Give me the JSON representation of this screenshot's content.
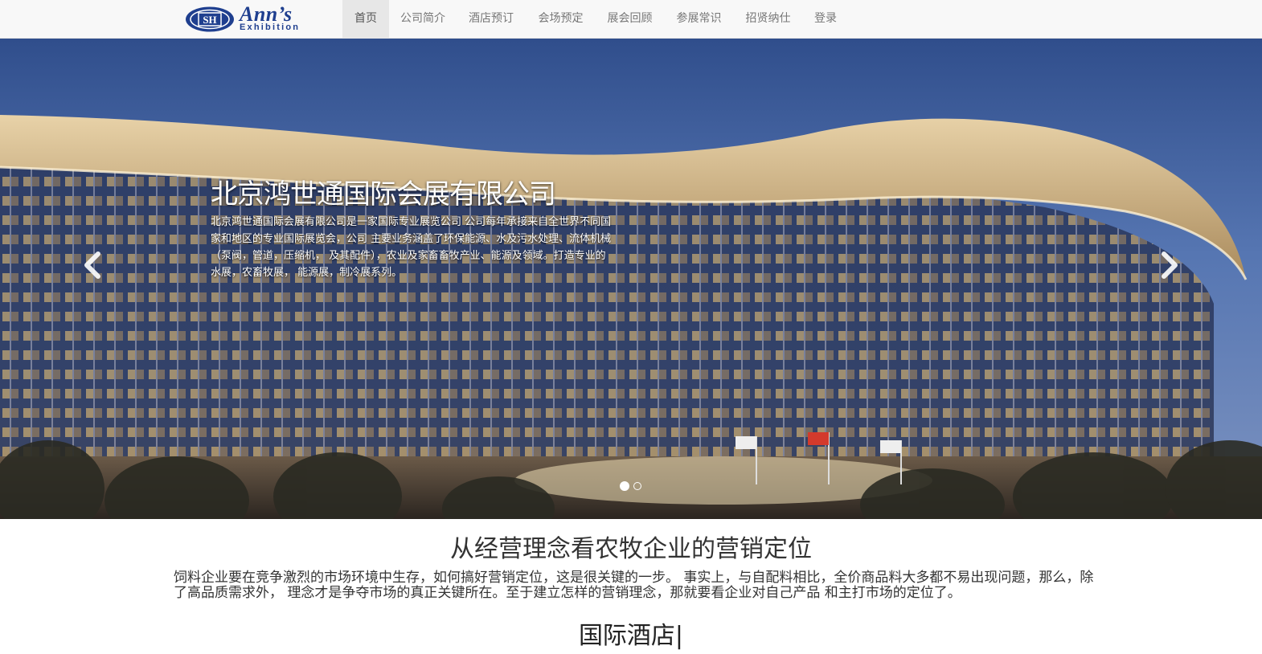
{
  "header": {
    "logo": {
      "brand": "Ann’s",
      "sub": "Exhibition",
      "mark": "SH"
    },
    "nav": [
      {
        "label": "首页",
        "active": true
      },
      {
        "label": "公司简介",
        "active": false
      },
      {
        "label": "酒店预订",
        "active": false
      },
      {
        "label": "会场预定",
        "active": false
      },
      {
        "label": "展会回顾",
        "active": false
      },
      {
        "label": "参展常识",
        "active": false
      },
      {
        "label": "招贤纳仕",
        "active": false
      },
      {
        "label": "登录",
        "active": false
      }
    ]
  },
  "hero": {
    "title": "北京鸿世通国际会展有限公司",
    "description": "北京鸿世通国际会展有限公司是一家国际专业展览公司 公司每年承接来自全世界不同国家和地区的专业国际展览会，公司 主要业务涵盖了环保能源、水及污水处理、流体机械（泵阀，管道，压缩机， 及其配件），农业及家畜畜牧产业、能源及领域。打造专业的水展，农畜牧展， 能源展，制冷展系列。",
    "prev_icon": "chevron-left-icon",
    "next_icon": "chevron-right-icon",
    "slides_total": 2,
    "active_slide": 1
  },
  "article": {
    "title": "从经营理念看农牧企业的营销定位",
    "body": "饲料企业要在竞争激烈的市场环境中生存，如何搞好营销定位，这是很关键的一步。 事实上，与自配料相比，全价商品料大多都不易出现问题，那么，除了高品质需求外， 理念才是争夺市场的真正关键所在。至于建立怎样的营销理念，那就要看企业对自己产品 和主打市场的定位了。"
  },
  "next_section": {
    "title": "国际酒店|"
  },
  "colors": {
    "brand_blue": "#1f3f8f",
    "nav_bg": "#f8f8f8",
    "nav_active": "#e7e7e7"
  }
}
